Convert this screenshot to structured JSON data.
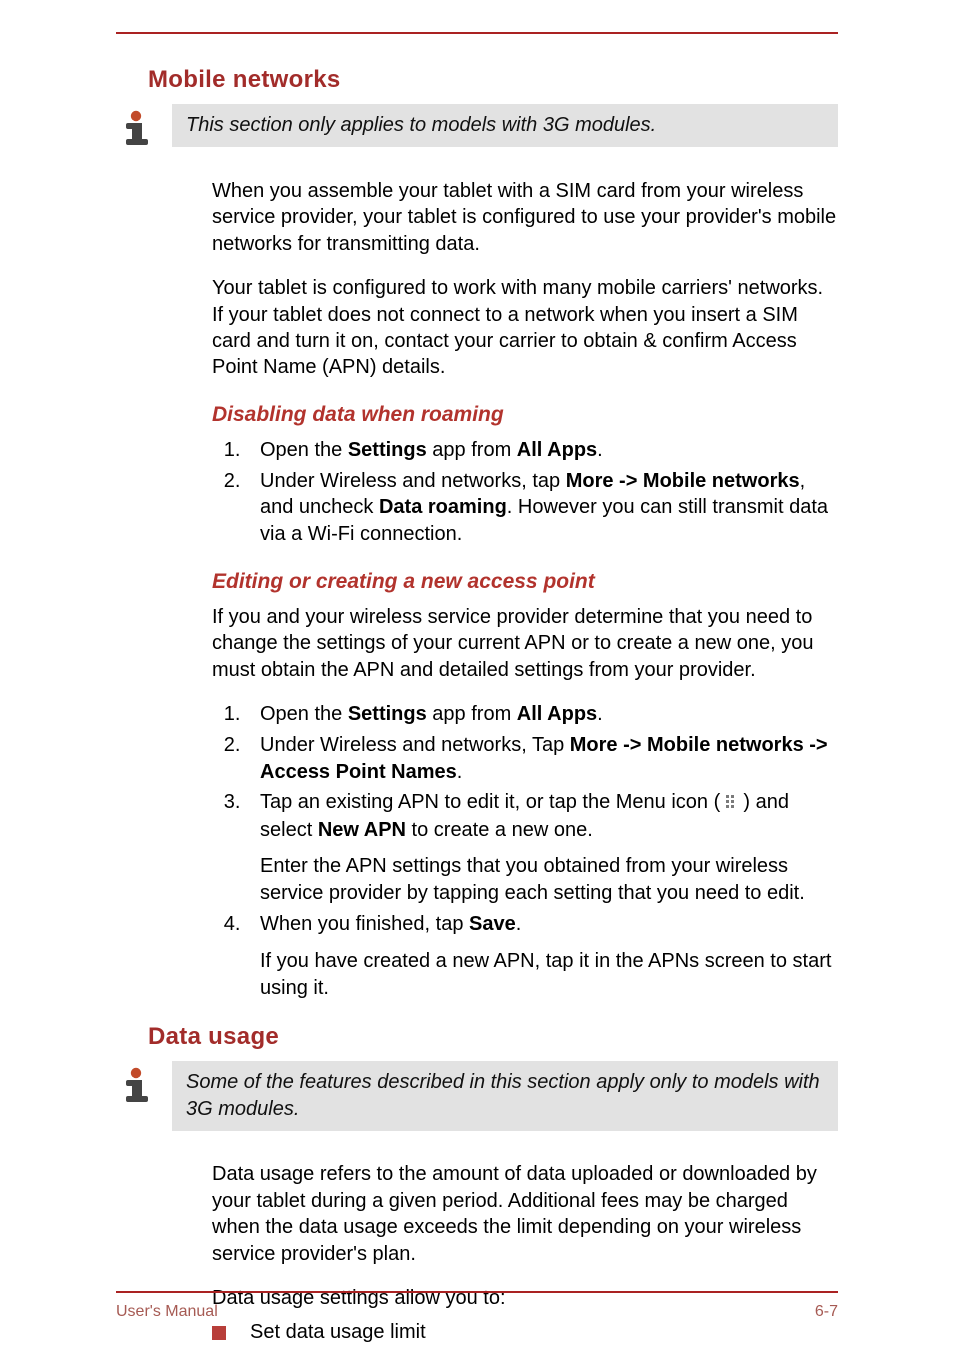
{
  "section1": {
    "title": "Mobile networks",
    "note": "This section only applies to models with 3G modules.",
    "para1": "When you assemble your tablet with a SIM card from your wireless service provider, your tablet is configured to use your provider's mobile networks for transmitting data.",
    "para2": "Your tablet is configured to work with many mobile carriers' networks. If your tablet does not connect to a network when you insert a SIM card and turn it on, contact your carrier to obtain & confirm Access Point Name (APN) details.",
    "sub1": {
      "title": "Disabling data when roaming",
      "step1_a": "Open the ",
      "step1_b": "Settings",
      "step1_c": " app from ",
      "step1_d": "All Apps",
      "step1_e": ".",
      "step2_a": "Under Wireless and networks, tap ",
      "step2_b": "More -> Mobile networks",
      "step2_c": ", and uncheck ",
      "step2_d": "Data roaming",
      "step2_e": ". However you can still transmit data via a Wi-Fi connection."
    },
    "sub2": {
      "title": "Editing or creating a new access point",
      "intro": "If you and your wireless service provider determine that you need to change the settings of your current APN or to create a new one, you must obtain the APN and detailed settings from your provider.",
      "step1_a": "Open the ",
      "step1_b": "Settings",
      "step1_c": " app from ",
      "step1_d": "All Apps",
      "step1_e": ".",
      "step2_a": "Under Wireless and networks, Tap ",
      "step2_b": "More -> Mobile networks -> Access Point Names",
      "step2_c": ".",
      "step3_a": "Tap an existing APN to edit it, or tap the Menu icon ( ",
      "step3_b": " ) and select ",
      "step3_c": "New APN",
      "step3_d": " to create a new one.",
      "step3_note": "Enter the APN settings that you obtained from your wireless service provider by tapping each setting that you need to edit.",
      "step4_a": "When you finished, tap ",
      "step4_b": "Save",
      "step4_c": ".",
      "step4_note": "If you have created a new APN, tap it in the APNs screen to start using it."
    }
  },
  "section2": {
    "title": "Data usage",
    "note": "Some of the features described in this section apply only to models with 3G modules.",
    "para1": "Data usage refers to the amount of data uploaded or downloaded by your tablet during a given period. Additional fees may be charged when the data usage exceeds the limit depending on your wireless service provider's plan.",
    "para2": "Data usage settings allow you to:",
    "bullet1": "Set data usage limit"
  },
  "footer": {
    "left": "User's Manual",
    "right": "6-7"
  }
}
